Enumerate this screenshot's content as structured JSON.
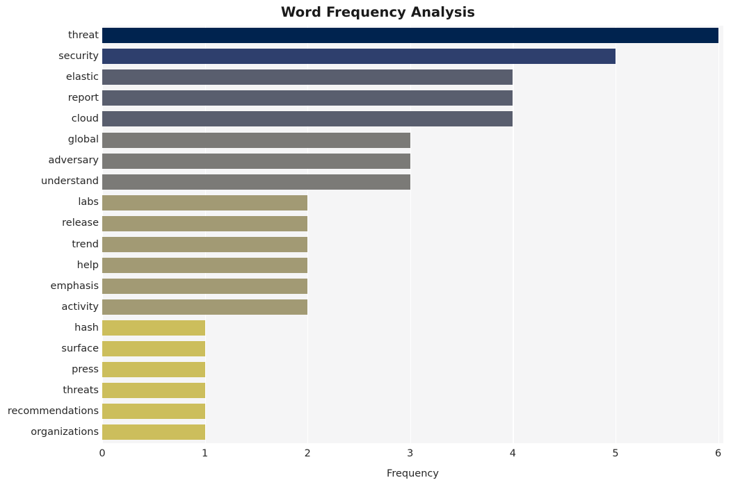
{
  "chart_data": {
    "type": "bar",
    "orientation": "horizontal",
    "title": "Word Frequency Analysis",
    "xlabel": "Frequency",
    "ylabel": "",
    "categories": [
      "threat",
      "security",
      "elastic",
      "report",
      "cloud",
      "global",
      "adversary",
      "understand",
      "labs",
      "release",
      "trend",
      "help",
      "emphasis",
      "activity",
      "hash",
      "surface",
      "press",
      "threats",
      "recommendations",
      "organizations"
    ],
    "values": [
      6,
      5,
      4,
      4,
      4,
      3,
      3,
      3,
      2,
      2,
      2,
      2,
      2,
      2,
      1,
      1,
      1,
      1,
      1,
      1
    ],
    "bar_colors": [
      "#00234f",
      "#2e3f6d",
      "#595e6e",
      "#595e6e",
      "#595e6e",
      "#7b7a77",
      "#7b7a77",
      "#7b7a77",
      "#a29a74",
      "#a29a74",
      "#a29a74",
      "#a29a74",
      "#a29a74",
      "#a29a74",
      "#ccbe5c",
      "#ccbe5c",
      "#ccbe5c",
      "#ccbe5c",
      "#ccbe5c",
      "#ccbe5c"
    ],
    "xlim": [
      0,
      6.05
    ],
    "xticks": [
      0,
      1,
      2,
      3,
      4,
      5,
      6
    ],
    "xtick_labels": [
      "0",
      "1",
      "2",
      "3",
      "4",
      "5",
      "6"
    ],
    "grid": true,
    "grid_axis": "x",
    "grid_color": "#ffffff",
    "plot_background": "#f5f5f6",
    "figure_background": "#ffffff",
    "legend": null
  }
}
